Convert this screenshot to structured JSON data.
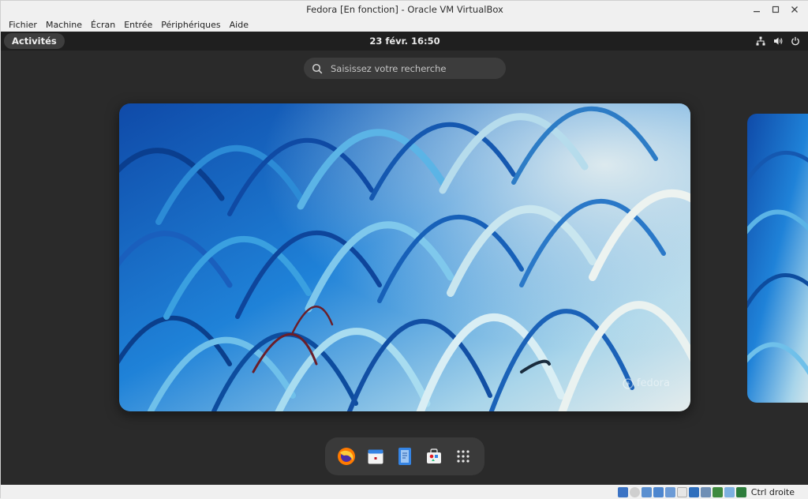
{
  "window": {
    "title": "Fedora [En fonction] - Oracle VM VirtualBox",
    "minimize_icon": "minimize-icon",
    "maximize_icon": "maximize-icon",
    "close_icon": "close-icon"
  },
  "menubar": {
    "items": [
      {
        "label": "Fichier"
      },
      {
        "label": "Machine"
      },
      {
        "label": "Écran"
      },
      {
        "label": "Entrée"
      },
      {
        "label": "Périphériques"
      },
      {
        "label": "Aide"
      }
    ]
  },
  "gnome": {
    "activities_label": "Activités",
    "clock": "23 févr.  16:50",
    "tray_icons": [
      "network-icon",
      "volume-icon",
      "power-icon"
    ],
    "search_placeholder": "Saisissez votre recherche",
    "wallpaper_watermark": "fedora",
    "dash_apps": [
      "firefox-icon",
      "calendar-icon",
      "text-editor-icon",
      "software-icon",
      "app-grid-icon"
    ]
  },
  "statusbar": {
    "host_key_label": "Ctrl droite",
    "icons": [
      "hard-disk-icon",
      "optical-disk-icon",
      "audio-icon",
      "network-adapter-icon",
      "usb-icon",
      "shared-folders-icon",
      "display-icon",
      "video-capture-icon",
      "cpu-icon",
      "mouse-integration-icon",
      "keyboard-icon"
    ]
  },
  "colors": {
    "gnome_topbar": "#1f1f1f",
    "overview_bg": "#2a2a2a",
    "wallpaper_blue": "#1f7fd6",
    "wallpaper_light": "#dfe8ea"
  }
}
